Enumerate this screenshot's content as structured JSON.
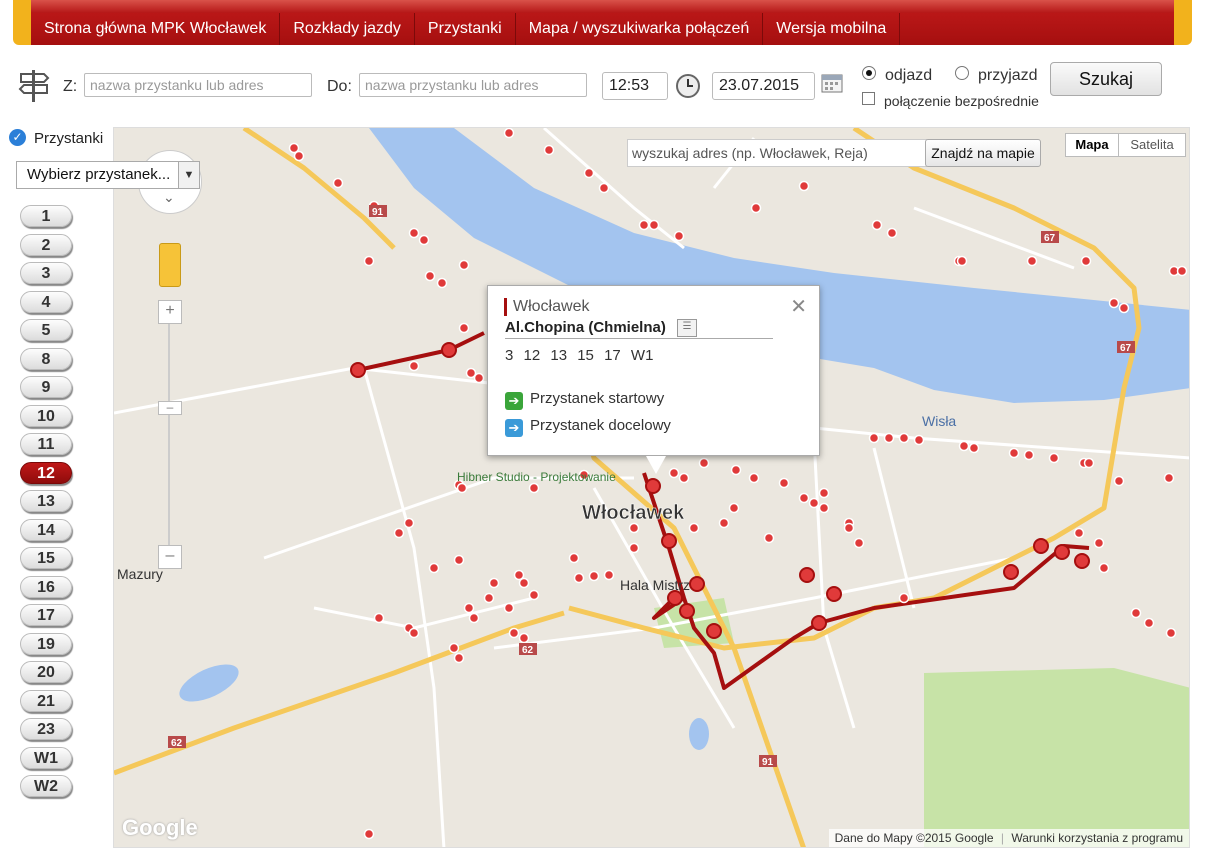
{
  "nav": {
    "items": [
      "Strona główna MPK Włocławek",
      "Rozkłady jazdy",
      "Przystanki",
      "Mapa / wyszukiwarka połączeń",
      "Wersja mobilna"
    ]
  },
  "search": {
    "from_label": "Z:",
    "from_placeholder": "nazwa przystanku lub adres",
    "to_label": "Do:",
    "to_placeholder": "nazwa przystanku lub adres",
    "time": "12:53",
    "date": "23.07.2015",
    "departure_label": "odjazd",
    "arrival_label": "przyjazd",
    "direct_label": "połączenie bezpośrednie",
    "search_button": "Szukaj"
  },
  "sidebar": {
    "stops_label": "Przystanki",
    "select_value": "Wybierz przystanek...",
    "lines": [
      "1",
      "2",
      "3",
      "4",
      "5",
      "8",
      "9",
      "10",
      "11",
      "12",
      "13",
      "14",
      "15",
      "16",
      "17",
      "19",
      "20",
      "21",
      "23",
      "W1",
      "W2"
    ],
    "active_line": "12"
  },
  "map": {
    "search_placeholder": "wyszukaj adres (np. Włocławek, Reja)",
    "search_button": "Znajdź na mapie",
    "type_map": "Mapa",
    "type_satellite": "Satelita",
    "city_label": "Włocławek",
    "place_labels": {
      "hala": "Hala Mistrz",
      "hibner": "Hibner Studio - Projektowanie",
      "mazury": "Mazury",
      "wisla": "Wisła"
    },
    "road_badges": [
      "91",
      "67",
      "67",
      "62",
      "62",
      "91"
    ],
    "popup": {
      "city": "Włocławek",
      "stop": "Al.Chopina (Chmielna)",
      "lines": "3 12 13 15 17 W1",
      "start_label": "Przystanek startowy",
      "end_label": "Przystanek docelowy"
    },
    "footer_data": "Dane do Mapy ©2015 Google",
    "footer_terms": "Warunki korzystania z programu",
    "logo": "Google"
  },
  "colors": {
    "brand_red": "#a50f0f",
    "brand_yellow": "#f2b21c",
    "route": "#a50f0f"
  }
}
